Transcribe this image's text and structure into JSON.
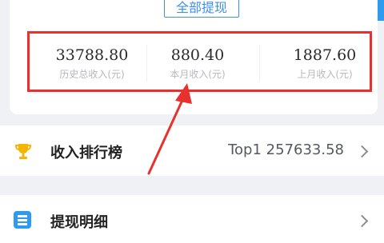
{
  "header": {
    "withdraw_all_label": "全部提现"
  },
  "income_summary": {
    "total": {
      "value": "33788.80",
      "label": "历史总收入(元)"
    },
    "this_month": {
      "value": "880.40",
      "label": "本月收入(元)"
    },
    "last_month": {
      "value": "1887.60",
      "label": "上月收入(元)"
    }
  },
  "menu": {
    "ranking": {
      "label": "收入排行榜",
      "value": "Top1 257633.58",
      "icon": "trophy-icon"
    },
    "withdraw_detail": {
      "label": "提现明细",
      "icon": "list-icon"
    }
  },
  "colors": {
    "accent": "#2d9bf0",
    "highlight": "#e8312f",
    "trophy": "#f5b400"
  }
}
